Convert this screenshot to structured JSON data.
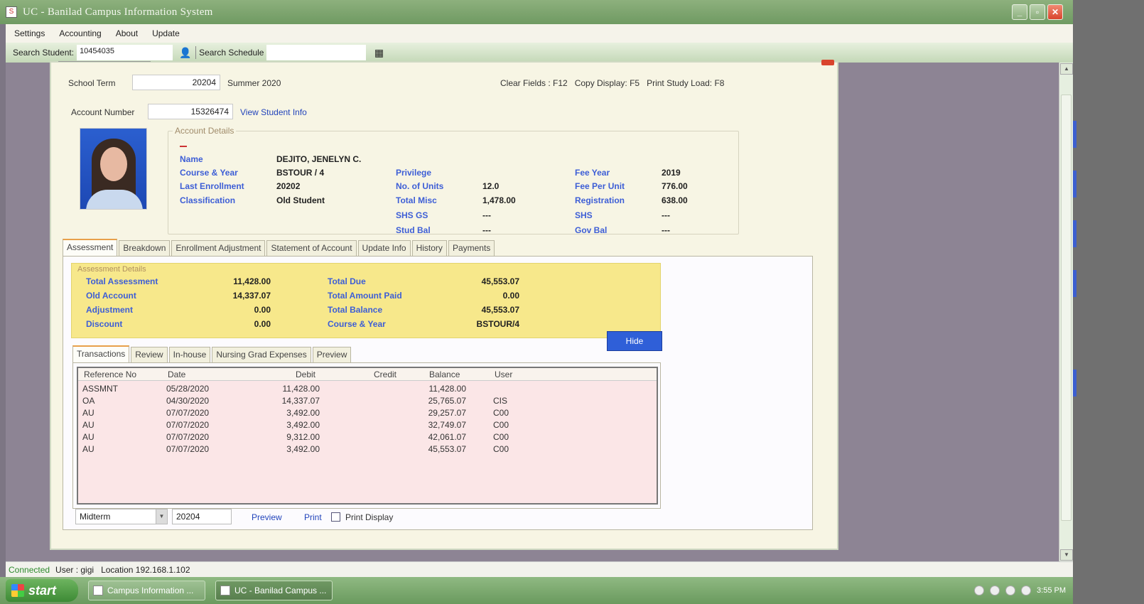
{
  "window": {
    "title": "UC - Banilad Campus Information System"
  },
  "menu": [
    "Settings",
    "Accounting",
    "About",
    "Update"
  ],
  "toolbar": {
    "search_student_label": "Search Student:",
    "search_student_value": "10454035",
    "search_schedule_label": "Search Schedule"
  },
  "form": {
    "school_term_label": "School Term",
    "school_term_value": "20204",
    "school_term_text": "Summer 2020",
    "shortcuts": "Clear Fields : F12   Copy Display: F5   Print Study Load: F8",
    "account_number_label": "Account Number",
    "account_number_value": "15326474",
    "view_student_info": "View Student Info"
  },
  "account_details": {
    "label": "Account Details",
    "name_label": "Name",
    "name_value": "DEJITO, JENELYN C.",
    "course_label": "Course & Year",
    "course_value": "BSTOUR / 4",
    "last_enroll_label": "Last Enrollment",
    "last_enroll_value": "20202",
    "class_label": "Classification",
    "class_value": "Old Student",
    "privilege_label": "Privilege",
    "units_label": "No. of Units",
    "units_value": "12.0",
    "misc_label": "Total Misc",
    "misc_value": "1,478.00",
    "shsgs_label": "SHS GS",
    "shsgs_value": "---",
    "studbal_label": "Stud Bal",
    "studbal_value": "---",
    "feeyear_label": "Fee Year",
    "feeyear_value": "2019",
    "feeunit_label": "Fee Per Unit",
    "feeunit_value": "776.00",
    "reg_label": "Registration",
    "reg_value": "638.00",
    "shs_label": "SHS",
    "shs_value": "---",
    "govbal_label": "Gov Bal",
    "govbal_value": "---"
  },
  "main_tabs": [
    "Assessment",
    "Breakdown",
    "Enrollment Adjustment",
    "Statement of Account",
    "Update Info",
    "History",
    "Payments"
  ],
  "assessment": {
    "label": "Assessment Details",
    "total_assessment_label": "Total Assessment",
    "total_assessment_value": "11,428.00",
    "old_account_label": "Old Account",
    "old_account_value": "14,337.07",
    "adjustment_label": "Adjustment",
    "adjustment_value": "0.00",
    "discount_label": "Discount",
    "discount_value": "0.00",
    "total_due_label": "Total Due",
    "total_due_value": "45,553.07",
    "amount_paid_label": "Total Amount Paid",
    "amount_paid_value": "0.00",
    "total_balance_label": "Total Balance",
    "total_balance_value": "45,553.07",
    "course_year_label": "Course & Year",
    "course_year_value": "BSTOUR/4",
    "hide_button": "Hide"
  },
  "sub_tabs": [
    "Transactions",
    "Review",
    "In-house",
    "Nursing Grad Expenses",
    "Preview"
  ],
  "transactions": {
    "columns": [
      "Reference No",
      "Date",
      "Debit",
      "Credit",
      "Balance",
      "User"
    ],
    "rows": [
      {
        "ref": "ASSMNT",
        "date": "05/28/2020",
        "debit": "11,428.00",
        "credit": "",
        "balance": "11,428.00",
        "user": ""
      },
      {
        "ref": "OA",
        "date": "04/30/2020",
        "debit": "14,337.07",
        "credit": "",
        "balance": "25,765.07",
        "user": "CIS"
      },
      {
        "ref": "AU",
        "date": "07/07/2020",
        "debit": "3,492.00",
        "credit": "",
        "balance": "29,257.07",
        "user": "C00"
      },
      {
        "ref": "AU",
        "date": "07/07/2020",
        "debit": "3,492.00",
        "credit": "",
        "balance": "32,749.07",
        "user": "C00"
      },
      {
        "ref": "AU",
        "date": "07/07/2020",
        "debit": "9,312.00",
        "credit": "",
        "balance": "42,061.07",
        "user": "C00"
      },
      {
        "ref": "AU",
        "date": "07/07/2020",
        "debit": "3,492.00",
        "credit": "",
        "balance": "45,553.07",
        "user": "C00"
      }
    ]
  },
  "bottom": {
    "period_value": "Midterm",
    "term_value": "20204",
    "preview_link": "Preview",
    "print_link": "Print",
    "print_display_label": "Print Display"
  },
  "status": {
    "connected": "Connected",
    "user": "User : gigi",
    "location": "Location 192.168.1.102"
  },
  "taskbar": {
    "start": "start",
    "task1": "Campus Information ...",
    "task2": "UC - Banilad Campus ...",
    "clock": "3:55 PM"
  }
}
